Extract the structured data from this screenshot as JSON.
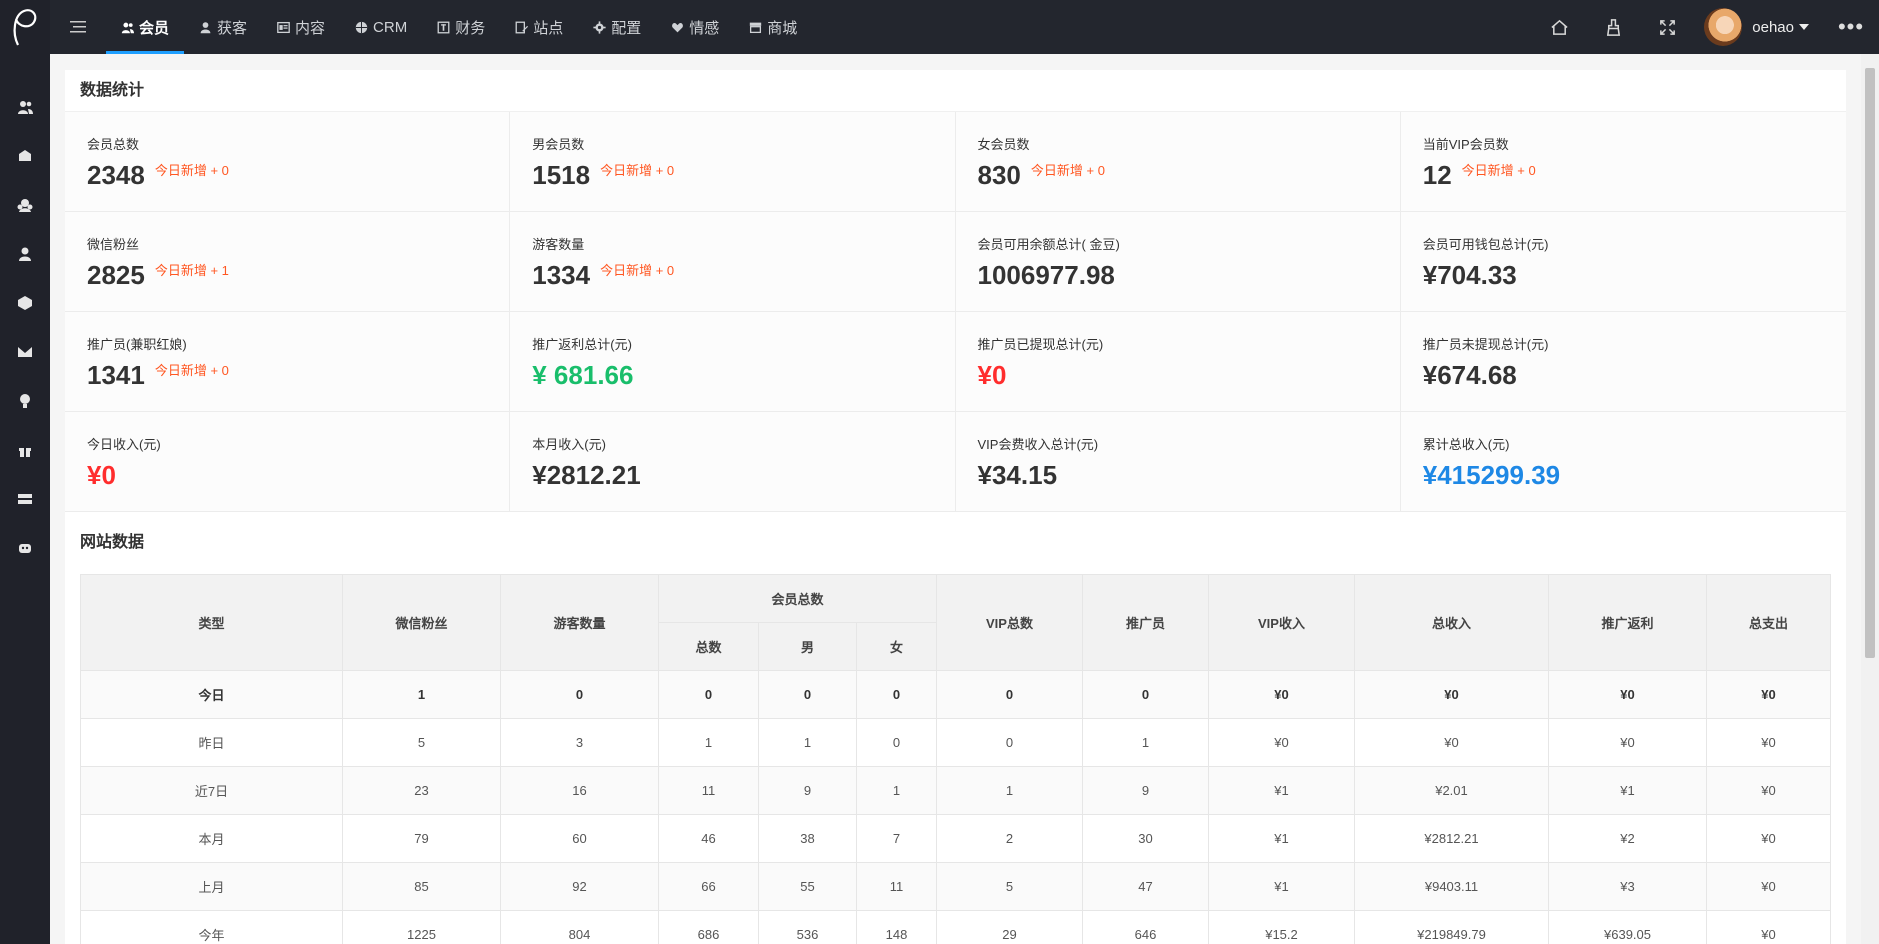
{
  "sidebar": {
    "icons": [
      "members-icon",
      "box-icon",
      "group-icon",
      "user-icon",
      "cube-icon",
      "mail-icon",
      "bulb-icon",
      "gift-icon",
      "server-icon",
      "robot-icon"
    ]
  },
  "nav": {
    "items": [
      {
        "label": "会员",
        "icon": "members-icon"
      },
      {
        "label": "获客",
        "icon": "user-icon"
      },
      {
        "label": "内容",
        "icon": "content-icon"
      },
      {
        "label": "CRM",
        "icon": "globe-icon"
      },
      {
        "label": "财务",
        "icon": "finance-icon"
      },
      {
        "label": "站点",
        "icon": "site-icon"
      },
      {
        "label": "配置",
        "icon": "gear-icon"
      },
      {
        "label": "情感",
        "icon": "heart-icon"
      },
      {
        "label": "商城",
        "icon": "store-icon"
      }
    ],
    "active_index": 0
  },
  "user": {
    "name": "oehao"
  },
  "stats_card": {
    "title": "数据统计",
    "today_prefix": "今日新增",
    "items": [
      {
        "label": "会员总数",
        "value": "2348",
        "today": "今日新增 + 0"
      },
      {
        "label": "男会员数",
        "value": "1518",
        "today": "今日新增 + 0"
      },
      {
        "label": "女会员数",
        "value": "830",
        "today": "今日新增 + 0"
      },
      {
        "label": "当前VIP会员数",
        "value": "12",
        "today": "今日新增 + 0"
      },
      {
        "label": "微信粉丝",
        "value": "2825",
        "today": "今日新增 + 1"
      },
      {
        "label": "游客数量",
        "value": "1334",
        "today": "今日新增 + 0"
      },
      {
        "label": "会员可用余额总计( 金豆)",
        "value": "1006977.98",
        "today": ""
      },
      {
        "label": "会员可用钱包总计(元)",
        "value": "¥704.33",
        "today": ""
      },
      {
        "label": "推广员(兼职红娘)",
        "value": "1341",
        "today": "今日新增 + 0"
      },
      {
        "label": "推广返利总计(元)",
        "value": "¥ 681.66",
        "today": "",
        "color": "#19be6b"
      },
      {
        "label": "推广员已提现总计(元)",
        "value": "¥0",
        "today": "",
        "color": "#ff2d2d"
      },
      {
        "label": "推广员未提现总计(元)",
        "value": "¥674.68",
        "today": ""
      },
      {
        "label": "今日收入(元)",
        "value": "¥0",
        "today": "",
        "color": "#ff2d2d"
      },
      {
        "label": "本月收入(元)",
        "value": "¥2812.21",
        "today": ""
      },
      {
        "label": "VIP会费收入总计(元)",
        "value": "¥34.15",
        "today": ""
      },
      {
        "label": "累计总收入(元)",
        "value": "¥415299.39",
        "today": "",
        "color": "#1e88e5"
      }
    ]
  },
  "site_card": {
    "title": "网站数据",
    "headers": {
      "type": "类型",
      "wechat": "微信粉丝",
      "visitor": "游客数量",
      "members": "会员总数",
      "total": "总数",
      "male": "男",
      "female": "女",
      "vip": "VIP总数",
      "promoter": "推广员",
      "vip_income": "VIP收入",
      "total_income": "总收入",
      "rebate": "推广返利",
      "expense": "总支出"
    },
    "rows": [
      [
        "今日",
        "1",
        "0",
        "0",
        "0",
        "0",
        "0",
        "0",
        "¥0",
        "¥0",
        "¥0",
        "¥0"
      ],
      [
        "昨日",
        "5",
        "3",
        "1",
        "1",
        "0",
        "0",
        "1",
        "¥0",
        "¥0",
        "¥0",
        "¥0"
      ],
      [
        "近7日",
        "23",
        "16",
        "11",
        "9",
        "1",
        "1",
        "9",
        "¥1",
        "¥2.01",
        "¥1",
        "¥0"
      ],
      [
        "本月",
        "79",
        "60",
        "46",
        "38",
        "7",
        "2",
        "30",
        "¥1",
        "¥2812.21",
        "¥2",
        "¥0"
      ],
      [
        "上月",
        "85",
        "92",
        "66",
        "55",
        "11",
        "5",
        "47",
        "¥1",
        "¥9403.11",
        "¥3",
        "¥0"
      ],
      [
        "今年",
        "1225",
        "804",
        "686",
        "536",
        "148",
        "29",
        "646",
        "¥15.2",
        "¥219849.79",
        "¥639.05",
        "¥0"
      ]
    ]
  }
}
